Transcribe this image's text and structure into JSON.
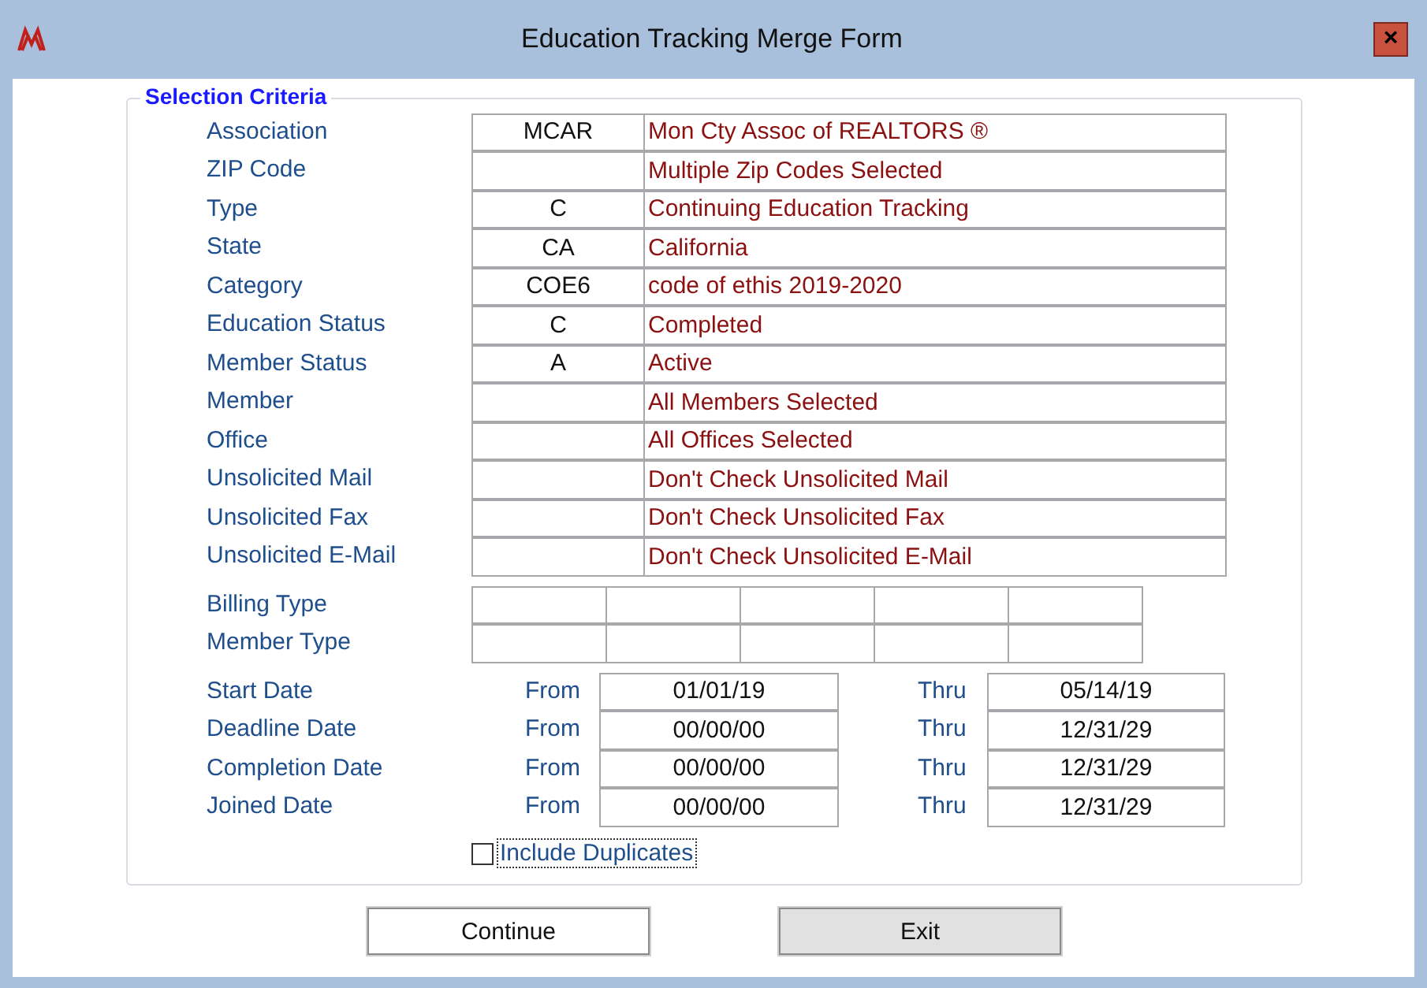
{
  "window": {
    "title": "Education Tracking Merge Form",
    "close": "×"
  },
  "group": {
    "title": "Selection Criteria"
  },
  "criteria": [
    {
      "label": "Association",
      "code": "MCAR",
      "description": "Mon Cty Assoc of REALTORS ®"
    },
    {
      "label": "ZIP Code",
      "description": "Multiple Zip Codes Selected"
    },
    {
      "label": "Type",
      "code": "C",
      "description": "Continuing Education Tracking"
    },
    {
      "label": "State",
      "code": "CA",
      "description": "California"
    },
    {
      "label": "Category",
      "code": "COE6",
      "description": "code of ethis 2019-2020"
    },
    {
      "label": "Education Status",
      "code": "C",
      "description": "Completed"
    },
    {
      "label": "Member Status",
      "code": "A",
      "description": "Active"
    },
    {
      "label": "Member",
      "description": "All Members Selected"
    },
    {
      "label": "Office",
      "description": "All Offices Selected"
    },
    {
      "label": "Unsolicited Mail",
      "description": "Don't Check Unsolicited Mail"
    },
    {
      "label": "Unsolicited Fax",
      "description": "Don't Check Unsolicited Fax"
    },
    {
      "label": "Unsolicited E-Mail",
      "description": "Don't Check Unsolicited E-Mail"
    }
  ],
  "type_rows": [
    {
      "label": "Billing Type"
    },
    {
      "label": "Member Type"
    }
  ],
  "dates": [
    {
      "label": "Start Date",
      "from_label": "From",
      "from": "01/01/19",
      "thru_label": "Thru",
      "thru": "05/14/19"
    },
    {
      "label": "Deadline Date",
      "from_label": "From",
      "from": "00/00/00",
      "thru_label": "Thru",
      "thru": "12/31/29"
    },
    {
      "label": "Completion Date",
      "from_label": "From",
      "from": "00/00/00",
      "thru_label": "Thru",
      "thru": "12/31/29"
    },
    {
      "label": "Joined Date",
      "from_label": "From",
      "from": "00/00/00",
      "thru_label": "Thru",
      "thru": "12/31/29"
    }
  ],
  "include_duplicates": {
    "label": "Include Duplicates",
    "checked": false,
    "focused": true
  },
  "buttons": [
    {
      "label": "Continue",
      "highlighted": false
    },
    {
      "label": "Exit",
      "highlighted": true
    }
  ]
}
